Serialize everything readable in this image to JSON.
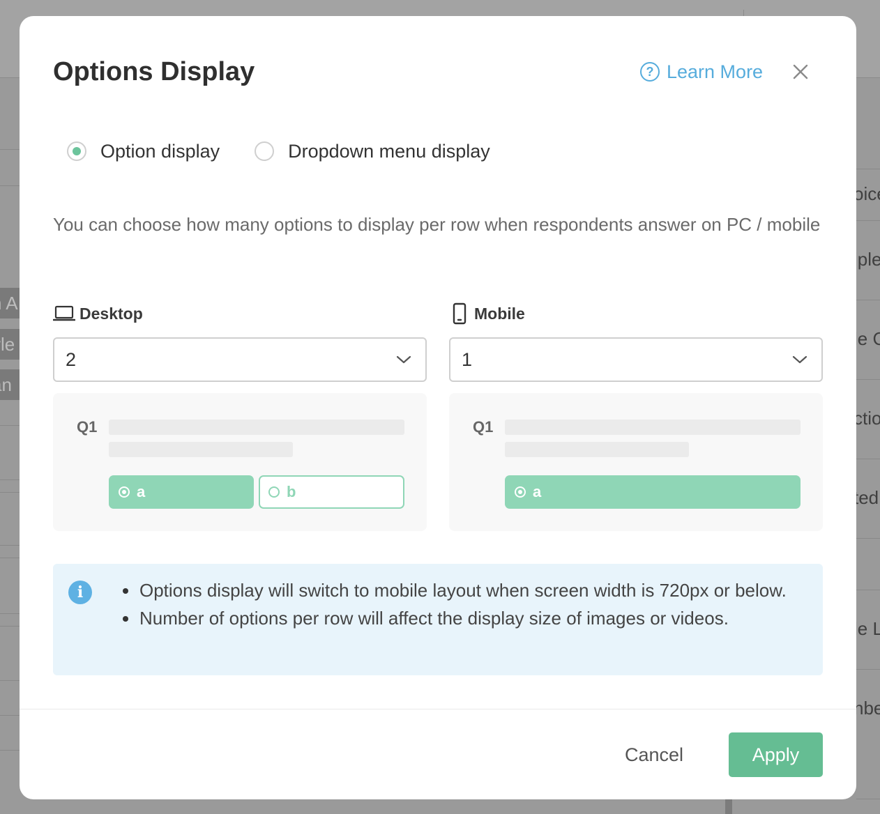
{
  "background": {
    "left_tags": [
      "n A",
      "yle",
      "an"
    ],
    "right_texts": [
      "oice",
      "iple",
      "le C",
      "ctio",
      "ted",
      "le L",
      "nbe"
    ]
  },
  "modal": {
    "title": "Options Display",
    "learn_more_label": "Learn More",
    "radio_options": [
      {
        "label": "Option display",
        "checked": true
      },
      {
        "label": "Dropdown menu display",
        "checked": false
      }
    ],
    "description": "You can choose how many options to display per row when respondents answer on PC / mobile",
    "desktop": {
      "label": "Desktop",
      "selected_value": "2",
      "preview": {
        "question": "Q1",
        "options": [
          "a",
          "b"
        ]
      }
    },
    "mobile": {
      "label": "Mobile",
      "selected_value": "1",
      "preview": {
        "question": "Q1",
        "options": [
          "a"
        ]
      }
    },
    "info": {
      "items": [
        "Options display will switch to mobile layout when screen width is 720px or below.",
        "Number of options per row will affect the display size of images or videos."
      ]
    },
    "cancel_label": "Cancel",
    "apply_label": "Apply"
  },
  "colors": {
    "accent_green": "#65bd93",
    "option_green": "#8fd6b6",
    "link_blue": "#56acdc",
    "info_bg": "#e8f4fb"
  }
}
